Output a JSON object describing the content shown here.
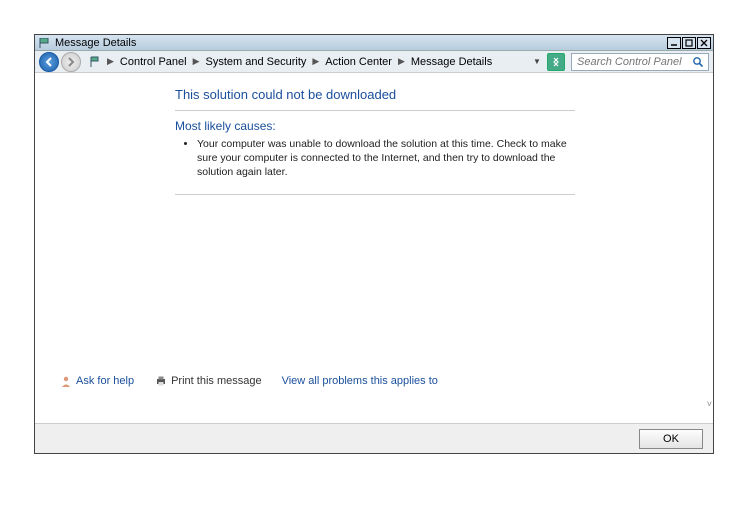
{
  "window": {
    "title": "Message Details"
  },
  "breadcrumb": {
    "items": [
      "Control Panel",
      "System and Security",
      "Action Center",
      "Message Details"
    ]
  },
  "search": {
    "placeholder": "Search Control Panel"
  },
  "page": {
    "heading": "This solution could not be downloaded",
    "subheading": "Most likely causes:",
    "cause": "Your computer was unable to download the solution at this time. Check to make sure your computer is connected to the Internet, and then try to download the solution again later."
  },
  "footer": {
    "help": "Ask for help",
    "print": "Print this message",
    "viewall": "View all problems this applies to"
  },
  "buttons": {
    "ok": "OK"
  }
}
